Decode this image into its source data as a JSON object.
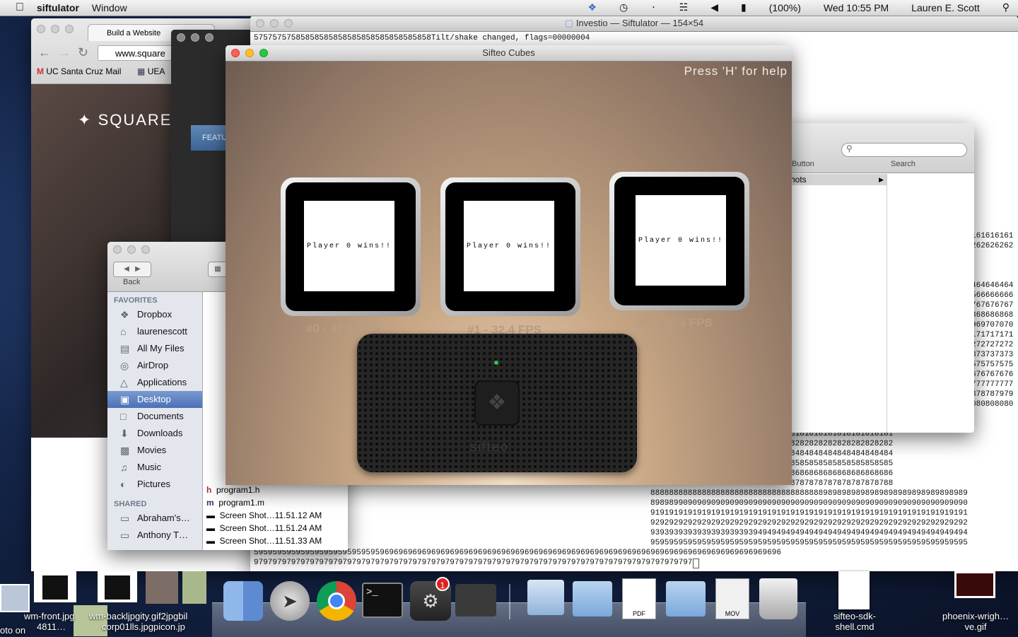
{
  "menubar": {
    "app_name": "siftulator",
    "menu_window": "Window",
    "battery": "(100%)",
    "clock": "Wed 10:55 PM",
    "user": "Lauren E. Scott"
  },
  "browser": {
    "tab_title": "Build a Website",
    "url": "www.square",
    "bookmark_1": "UC Santa Cruz Mail",
    "bookmark_2": "UEA",
    "logo_text": "SQUARE",
    "feature_label": "FEATU"
  },
  "terminal": {
    "title": "Investio — Siftulator — 154×54",
    "top_line": "57575757585858585858585858585858585858Tilt/shake changed, flags=00000004",
    "right_lines": [
      "161616161",
      "262626262",
      "",
      "",
      "",
      "464646464",
      "566666666",
      "767676767",
      "868686868",
      "969707070",
      "171717171",
      "272727272",
      "373737373",
      "575757575",
      "676767676",
      "777777777",
      "878787979",
      "080808080"
    ],
    "bottom_lines": [
      "8181818181818181818181818181818181818181818181818181",
      "8282828282828282828282828282828282828282828282828282",
      "8383838383838383838383838484848484848484848484848484",
      "8585858585858585858585858585858585858585858585858585",
      "8686868686868686868686868686868686868686868686868686",
      "8787878787878787878787878787878787878787878787878788",
      "88888888888888888888888888888888888889898989898989898989898989898989",
      "89898990909090909090909090909090909090909090909090909090909090909090",
      "91919191919191919191919191919191919191919191919191919191919191919191",
      "92929292929292929292929292929292929292929292929292929292929292929292",
      "93939393939393939393939494949494949494949494949494949494949494949494",
      "95959595959595959595959595959595959595959595959595959595959595959595",
      "59595959595959595959595959596969696969696969696969696969696969696969696969696969696969696969696969696969696969696",
      "9797979797979797979797979797979797979797979797979797979797979797979797979797979797979797979797"
    ]
  },
  "finder": {
    "back_label": "Back",
    "favorites_header": "FAVORITES",
    "favorites": [
      "Dropbox",
      "laurenescott",
      "All My Files",
      "AirDrop",
      "Applications",
      "Desktop",
      "Documents",
      "Downloads",
      "Movies",
      "Music",
      "Pictures"
    ],
    "shared_header": "SHARED",
    "shared": [
      "Abraham's…",
      "Anthony T…"
    ],
    "files": [
      "program1.h",
      "program1.m",
      "Screen Shot…11.51.12 AM",
      "Screen Shot…11.51.24 AM",
      "Screen Shot…11.51.33 AM"
    ],
    "selected": "Desktop"
  },
  "prefs_window": {
    "button_label": "Button",
    "search_label": "Search",
    "list_item": "hots"
  },
  "sifteo": {
    "title": "Sifteo Cubes",
    "help_text": "Press 'H' for help",
    "cubes": [
      {
        "message": "Player 0 wins!!",
        "fps": "#0 - 32.4 FPS"
      },
      {
        "message": "Player 0 wins!!",
        "fps": "#1 - 32.4 FPS"
      },
      {
        "message": "Player 0 wins!!",
        "fps": "#2 - 34.4 FPS"
      }
    ],
    "base_brand": "sifteo"
  },
  "desktop": {
    "left_labels": [
      "wm-front.jpg",
      "wm-backljpgity.gif2jpgbil",
      "4811…",
      "corp01lls.jpgpicon.jp",
      "oto on"
    ],
    "right_icons": [
      "sifteo-sdk-shell.cmd",
      "phoenix-wrigh…ve.gif"
    ]
  },
  "dock": {
    "steam_badge": "1",
    "pdf_label": "PDF",
    "mov_label": "MOV"
  }
}
